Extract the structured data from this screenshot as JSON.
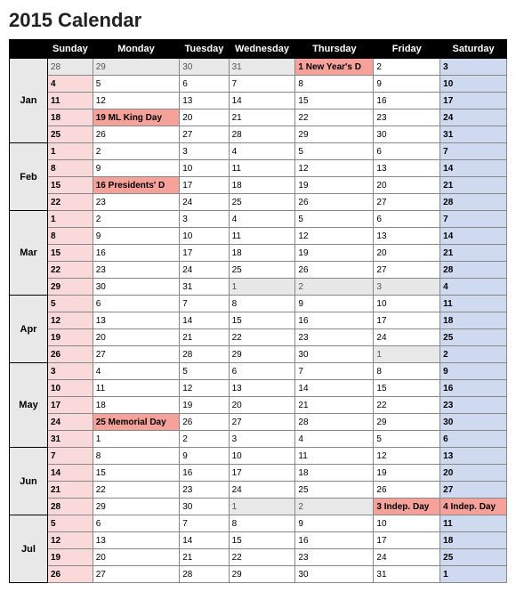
{
  "title": "2015 Calendar",
  "headers": [
    "",
    "Sunday",
    "Monday",
    "Tuesday",
    "Wednesday",
    "Thursday",
    "Friday",
    "Saturday"
  ],
  "months": [
    {
      "label": "Jan",
      "rows": [
        [
          {
            "v": "28",
            "c": "prev"
          },
          {
            "v": "29",
            "c": "prev"
          },
          {
            "v": "30",
            "c": "prev"
          },
          {
            "v": "31",
            "c": "prev"
          },
          {
            "v": "1 New Year's D",
            "c": "hol"
          },
          {
            "v": "2",
            "c": "norm"
          },
          {
            "v": "3",
            "c": "sat"
          }
        ],
        [
          {
            "v": "4",
            "c": "sun"
          },
          {
            "v": "5",
            "c": "norm"
          },
          {
            "v": "6",
            "c": "norm"
          },
          {
            "v": "7",
            "c": "norm"
          },
          {
            "v": "8",
            "c": "norm"
          },
          {
            "v": "9",
            "c": "norm"
          },
          {
            "v": "10",
            "c": "sat"
          }
        ],
        [
          {
            "v": "11",
            "c": "sun"
          },
          {
            "v": "12",
            "c": "norm"
          },
          {
            "v": "13",
            "c": "norm"
          },
          {
            "v": "14",
            "c": "norm"
          },
          {
            "v": "15",
            "c": "norm"
          },
          {
            "v": "16",
            "c": "norm"
          },
          {
            "v": "17",
            "c": "sat"
          }
        ],
        [
          {
            "v": "18",
            "c": "sun"
          },
          {
            "v": "19 ML King Day",
            "c": "hol"
          },
          {
            "v": "20",
            "c": "norm"
          },
          {
            "v": "21",
            "c": "norm"
          },
          {
            "v": "22",
            "c": "norm"
          },
          {
            "v": "23",
            "c": "norm"
          },
          {
            "v": "24",
            "c": "sat"
          }
        ],
        [
          {
            "v": "25",
            "c": "sun"
          },
          {
            "v": "26",
            "c": "norm"
          },
          {
            "v": "27",
            "c": "norm"
          },
          {
            "v": "28",
            "c": "norm"
          },
          {
            "v": "29",
            "c": "norm"
          },
          {
            "v": "30",
            "c": "norm"
          },
          {
            "v": "31",
            "c": "sat"
          }
        ]
      ]
    },
    {
      "label": "Feb",
      "rows": [
        [
          {
            "v": "1",
            "c": "sun"
          },
          {
            "v": "2",
            "c": "norm"
          },
          {
            "v": "3",
            "c": "norm"
          },
          {
            "v": "4",
            "c": "norm"
          },
          {
            "v": "5",
            "c": "norm"
          },
          {
            "v": "6",
            "c": "norm"
          },
          {
            "v": "7",
            "c": "sat"
          }
        ],
        [
          {
            "v": "8",
            "c": "sun"
          },
          {
            "v": "9",
            "c": "norm"
          },
          {
            "v": "10",
            "c": "norm"
          },
          {
            "v": "11",
            "c": "norm"
          },
          {
            "v": "12",
            "c": "norm"
          },
          {
            "v": "13",
            "c": "norm"
          },
          {
            "v": "14",
            "c": "sat"
          }
        ],
        [
          {
            "v": "15",
            "c": "sun"
          },
          {
            "v": "16 Presidents' D",
            "c": "hol"
          },
          {
            "v": "17",
            "c": "norm"
          },
          {
            "v": "18",
            "c": "norm"
          },
          {
            "v": "19",
            "c": "norm"
          },
          {
            "v": "20",
            "c": "norm"
          },
          {
            "v": "21",
            "c": "sat"
          }
        ],
        [
          {
            "v": "22",
            "c": "sun"
          },
          {
            "v": "23",
            "c": "norm"
          },
          {
            "v": "24",
            "c": "norm"
          },
          {
            "v": "25",
            "c": "norm"
          },
          {
            "v": "26",
            "c": "norm"
          },
          {
            "v": "27",
            "c": "norm"
          },
          {
            "v": "28",
            "c": "sat"
          }
        ]
      ]
    },
    {
      "label": "Mar",
      "rows": [
        [
          {
            "v": "1",
            "c": "sun"
          },
          {
            "v": "2",
            "c": "norm"
          },
          {
            "v": "3",
            "c": "norm"
          },
          {
            "v": "4",
            "c": "norm"
          },
          {
            "v": "5",
            "c": "norm"
          },
          {
            "v": "6",
            "c": "norm"
          },
          {
            "v": "7",
            "c": "sat"
          }
        ],
        [
          {
            "v": "8",
            "c": "sun"
          },
          {
            "v": "9",
            "c": "norm"
          },
          {
            "v": "10",
            "c": "norm"
          },
          {
            "v": "11",
            "c": "norm"
          },
          {
            "v": "12",
            "c": "norm"
          },
          {
            "v": "13",
            "c": "norm"
          },
          {
            "v": "14",
            "c": "sat"
          }
        ],
        [
          {
            "v": "15",
            "c": "sun"
          },
          {
            "v": "16",
            "c": "norm"
          },
          {
            "v": "17",
            "c": "norm"
          },
          {
            "v": "18",
            "c": "norm"
          },
          {
            "v": "19",
            "c": "norm"
          },
          {
            "v": "20",
            "c": "norm"
          },
          {
            "v": "21",
            "c": "sat"
          }
        ],
        [
          {
            "v": "22",
            "c": "sun"
          },
          {
            "v": "23",
            "c": "norm"
          },
          {
            "v": "24",
            "c": "norm"
          },
          {
            "v": "25",
            "c": "norm"
          },
          {
            "v": "26",
            "c": "norm"
          },
          {
            "v": "27",
            "c": "norm"
          },
          {
            "v": "28",
            "c": "sat"
          }
        ],
        [
          {
            "v": "29",
            "c": "sun"
          },
          {
            "v": "30",
            "c": "norm"
          },
          {
            "v": "31",
            "c": "norm"
          },
          {
            "v": "1",
            "c": "prev"
          },
          {
            "v": "2",
            "c": "prev"
          },
          {
            "v": "3",
            "c": "prev"
          },
          {
            "v": "4",
            "c": "sat"
          }
        ]
      ]
    },
    {
      "label": "Apr",
      "rows": [
        [
          {
            "v": "5",
            "c": "sun"
          },
          {
            "v": "6",
            "c": "norm"
          },
          {
            "v": "7",
            "c": "norm"
          },
          {
            "v": "8",
            "c": "norm"
          },
          {
            "v": "9",
            "c": "norm"
          },
          {
            "v": "10",
            "c": "norm"
          },
          {
            "v": "11",
            "c": "sat"
          }
        ],
        [
          {
            "v": "12",
            "c": "sun"
          },
          {
            "v": "13",
            "c": "norm"
          },
          {
            "v": "14",
            "c": "norm"
          },
          {
            "v": "15",
            "c": "norm"
          },
          {
            "v": "16",
            "c": "norm"
          },
          {
            "v": "17",
            "c": "norm"
          },
          {
            "v": "18",
            "c": "sat"
          }
        ],
        [
          {
            "v": "19",
            "c": "sun"
          },
          {
            "v": "20",
            "c": "norm"
          },
          {
            "v": "21",
            "c": "norm"
          },
          {
            "v": "22",
            "c": "norm"
          },
          {
            "v": "23",
            "c": "norm"
          },
          {
            "v": "24",
            "c": "norm"
          },
          {
            "v": "25",
            "c": "sat"
          }
        ],
        [
          {
            "v": "26",
            "c": "sun"
          },
          {
            "v": "27",
            "c": "norm"
          },
          {
            "v": "28",
            "c": "norm"
          },
          {
            "v": "29",
            "c": "norm"
          },
          {
            "v": "30",
            "c": "norm"
          },
          {
            "v": "1",
            "c": "prev"
          },
          {
            "v": "2",
            "c": "sat"
          }
        ]
      ]
    },
    {
      "label": "May",
      "rows": [
        [
          {
            "v": "3",
            "c": "sun"
          },
          {
            "v": "4",
            "c": "norm"
          },
          {
            "v": "5",
            "c": "norm"
          },
          {
            "v": "6",
            "c": "norm"
          },
          {
            "v": "7",
            "c": "norm"
          },
          {
            "v": "8",
            "c": "norm"
          },
          {
            "v": "9",
            "c": "sat"
          }
        ],
        [
          {
            "v": "10",
            "c": "sun"
          },
          {
            "v": "11",
            "c": "norm"
          },
          {
            "v": "12",
            "c": "norm"
          },
          {
            "v": "13",
            "c": "norm"
          },
          {
            "v": "14",
            "c": "norm"
          },
          {
            "v": "15",
            "c": "norm"
          },
          {
            "v": "16",
            "c": "sat"
          }
        ],
        [
          {
            "v": "17",
            "c": "sun"
          },
          {
            "v": "18",
            "c": "norm"
          },
          {
            "v": "19",
            "c": "norm"
          },
          {
            "v": "20",
            "c": "norm"
          },
          {
            "v": "21",
            "c": "norm"
          },
          {
            "v": "22",
            "c": "norm"
          },
          {
            "v": "23",
            "c": "sat"
          }
        ],
        [
          {
            "v": "24",
            "c": "sun"
          },
          {
            "v": "25 Memorial Day",
            "c": "hol"
          },
          {
            "v": "26",
            "c": "norm"
          },
          {
            "v": "27",
            "c": "norm"
          },
          {
            "v": "28",
            "c": "norm"
          },
          {
            "v": "29",
            "c": "norm"
          },
          {
            "v": "30",
            "c": "sat"
          }
        ],
        [
          {
            "v": "31",
            "c": "sun"
          },
          {
            "v": "1",
            "c": "norm"
          },
          {
            "v": "2",
            "c": "norm"
          },
          {
            "v": "3",
            "c": "norm"
          },
          {
            "v": "4",
            "c": "norm"
          },
          {
            "v": "5",
            "c": "norm"
          },
          {
            "v": "6",
            "c": "sat"
          }
        ]
      ]
    },
    {
      "label": "Jun",
      "rows": [
        [
          {
            "v": "7",
            "c": "sun"
          },
          {
            "v": "8",
            "c": "norm"
          },
          {
            "v": "9",
            "c": "norm"
          },
          {
            "v": "10",
            "c": "norm"
          },
          {
            "v": "11",
            "c": "norm"
          },
          {
            "v": "12",
            "c": "norm"
          },
          {
            "v": "13",
            "c": "sat"
          }
        ],
        [
          {
            "v": "14",
            "c": "sun"
          },
          {
            "v": "15",
            "c": "norm"
          },
          {
            "v": "16",
            "c": "norm"
          },
          {
            "v": "17",
            "c": "norm"
          },
          {
            "v": "18",
            "c": "norm"
          },
          {
            "v": "19",
            "c": "norm"
          },
          {
            "v": "20",
            "c": "sat"
          }
        ],
        [
          {
            "v": "21",
            "c": "sun"
          },
          {
            "v": "22",
            "c": "norm"
          },
          {
            "v": "23",
            "c": "norm"
          },
          {
            "v": "24",
            "c": "norm"
          },
          {
            "v": "25",
            "c": "norm"
          },
          {
            "v": "26",
            "c": "norm"
          },
          {
            "v": "27",
            "c": "sat"
          }
        ],
        [
          {
            "v": "28",
            "c": "sun"
          },
          {
            "v": "29",
            "c": "norm"
          },
          {
            "v": "30",
            "c": "norm"
          },
          {
            "v": "1",
            "c": "prev"
          },
          {
            "v": "2",
            "c": "prev"
          },
          {
            "v": "3 Indep. Day",
            "c": "hol"
          },
          {
            "v": "4 Indep. Day",
            "c": "hol"
          }
        ]
      ]
    },
    {
      "label": "Jul",
      "rows": [
        [
          {
            "v": "5",
            "c": "sun"
          },
          {
            "v": "6",
            "c": "norm"
          },
          {
            "v": "7",
            "c": "norm"
          },
          {
            "v": "8",
            "c": "norm"
          },
          {
            "v": "9",
            "c": "norm"
          },
          {
            "v": "10",
            "c": "norm"
          },
          {
            "v": "11",
            "c": "sat"
          }
        ],
        [
          {
            "v": "12",
            "c": "sun"
          },
          {
            "v": "13",
            "c": "norm"
          },
          {
            "v": "14",
            "c": "norm"
          },
          {
            "v": "15",
            "c": "norm"
          },
          {
            "v": "16",
            "c": "norm"
          },
          {
            "v": "17",
            "c": "norm"
          },
          {
            "v": "18",
            "c": "sat"
          }
        ],
        [
          {
            "v": "19",
            "c": "sun"
          },
          {
            "v": "20",
            "c": "norm"
          },
          {
            "v": "21",
            "c": "norm"
          },
          {
            "v": "22",
            "c": "norm"
          },
          {
            "v": "23",
            "c": "norm"
          },
          {
            "v": "24",
            "c": "norm"
          },
          {
            "v": "25",
            "c": "sat"
          }
        ],
        [
          {
            "v": "26",
            "c": "sun"
          },
          {
            "v": "27",
            "c": "norm"
          },
          {
            "v": "28",
            "c": "norm"
          },
          {
            "v": "29",
            "c": "norm"
          },
          {
            "v": "30",
            "c": "norm"
          },
          {
            "v": "31",
            "c": "norm"
          },
          {
            "v": "1",
            "c": "sat"
          }
        ]
      ]
    }
  ]
}
